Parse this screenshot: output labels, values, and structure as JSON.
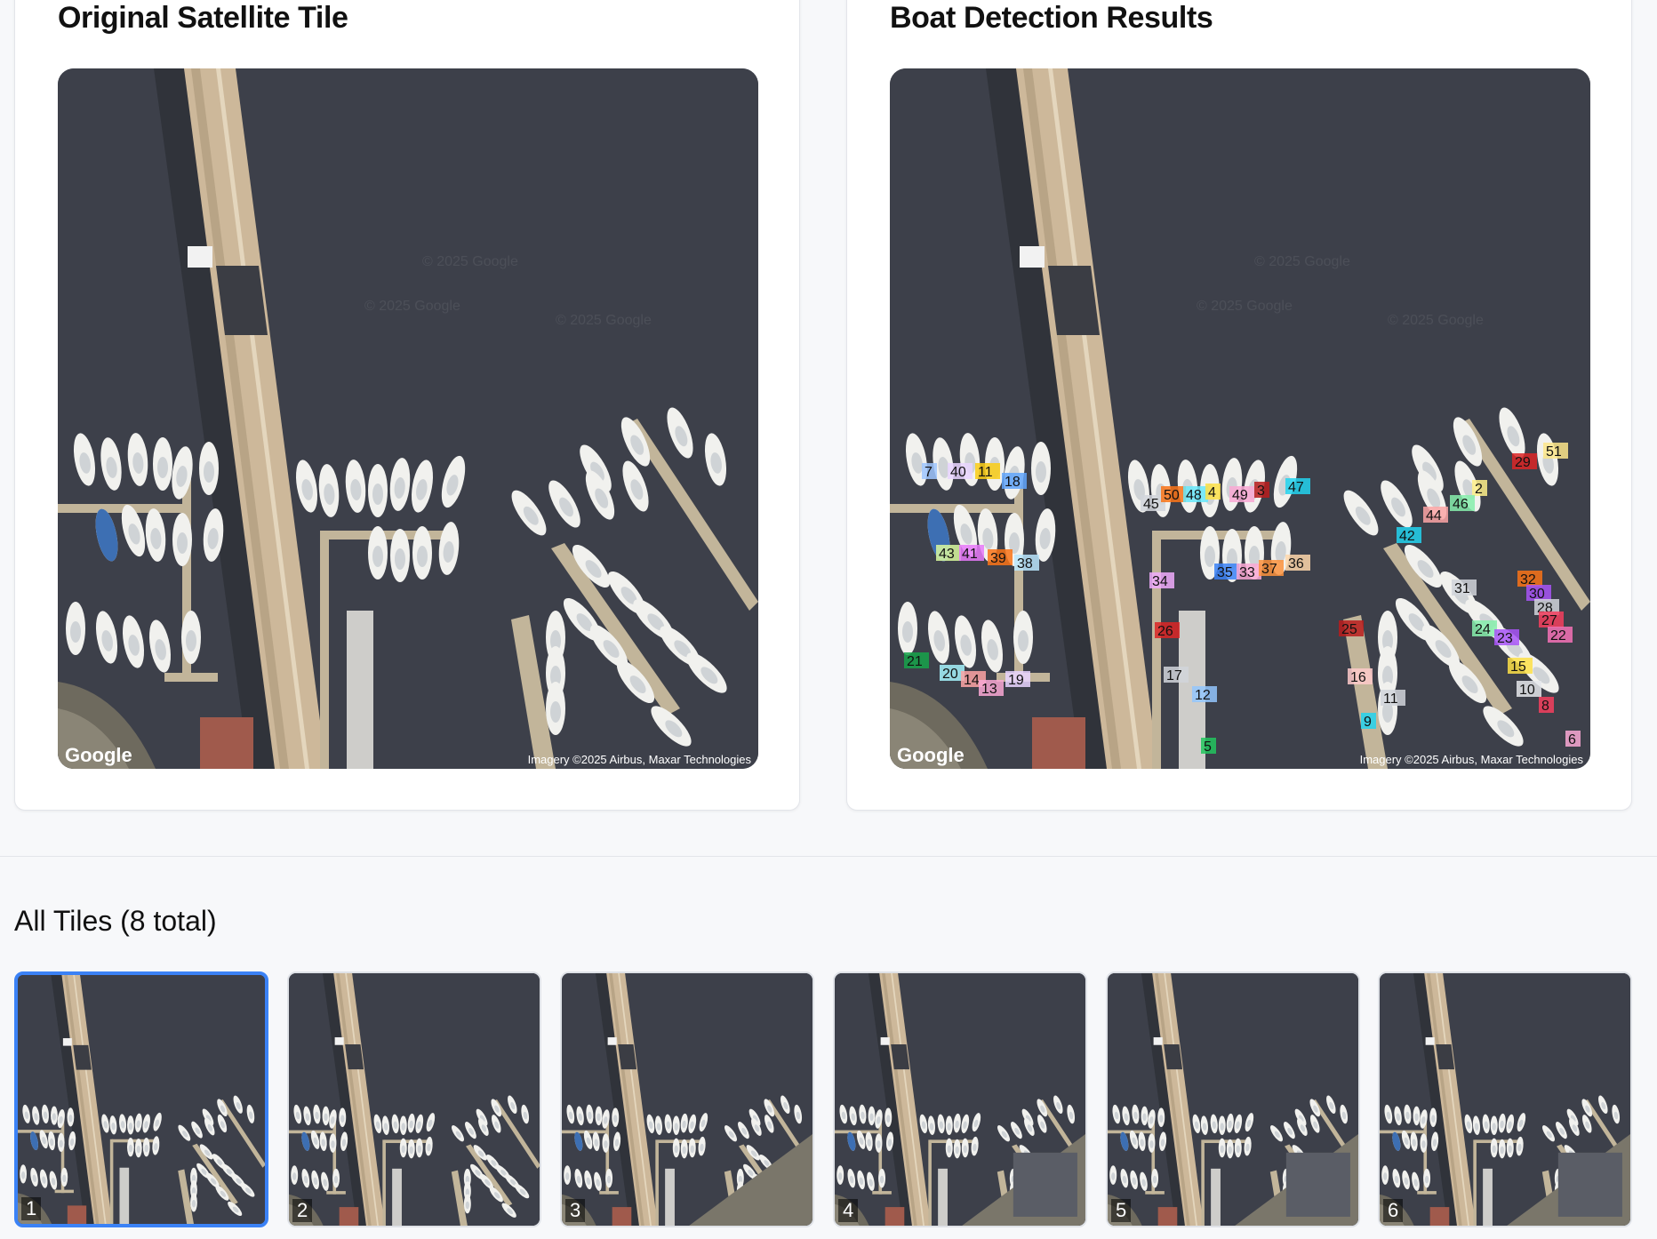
{
  "left_panel": {
    "title": "Original Satellite Tile"
  },
  "right_panel": {
    "title": "Boat Detection Results"
  },
  "map": {
    "google_logo": "Google",
    "attribution": "Imagery ©2025 Airbus, Maxar Technologies",
    "watermark": "© 2025 Google"
  },
  "tiles_section": {
    "title": "All Tiles (8 total)"
  },
  "thumbnails": [
    {
      "num": "1",
      "selected": true
    },
    {
      "num": "2",
      "selected": false
    },
    {
      "num": "3",
      "selected": false
    },
    {
      "num": "4",
      "selected": false
    },
    {
      "num": "5",
      "selected": false
    },
    {
      "num": "6",
      "selected": false
    }
  ],
  "detections": [
    {
      "id": "7",
      "color": "#9ec5fe"
    },
    {
      "id": "40",
      "color": "#e9d5ff"
    },
    {
      "id": "11",
      "color": "#facc15"
    },
    {
      "id": "18",
      "color": "#60a5fa"
    },
    {
      "id": "45",
      "color": "#d1d5db"
    },
    {
      "id": "50",
      "color": "#f97316"
    },
    {
      "id": "48",
      "color": "#67e8f9"
    },
    {
      "id": "4",
      "color": "#fde047"
    },
    {
      "id": "49",
      "color": "#f9a8d4"
    },
    {
      "id": "3",
      "color": "#b91c1c"
    },
    {
      "id": "47",
      "color": "#22d3ee"
    },
    {
      "id": "29",
      "color": "#dc2626"
    },
    {
      "id": "51",
      "color": "#fde68a"
    },
    {
      "id": "2",
      "color": "#fef08a"
    },
    {
      "id": "46",
      "color": "#86efac"
    },
    {
      "id": "44",
      "color": "#fca5a5"
    },
    {
      "id": "42",
      "color": "#22d3ee"
    },
    {
      "id": "43",
      "color": "#d9f99d"
    },
    {
      "id": "41",
      "color": "#e879f9"
    },
    {
      "id": "39",
      "color": "#f97316"
    },
    {
      "id": "38",
      "color": "#bae6fd"
    },
    {
      "id": "34",
      "color": "#f0abfc"
    },
    {
      "id": "35",
      "color": "#3b82f6"
    },
    {
      "id": "33",
      "color": "#f9a8d4"
    },
    {
      "id": "37",
      "color": "#fb923c"
    },
    {
      "id": "36",
      "color": "#fed7aa"
    },
    {
      "id": "31",
      "color": "#d1d5db"
    },
    {
      "id": "32",
      "color": "#f97316"
    },
    {
      "id": "30",
      "color": "#a855f7"
    },
    {
      "id": "28",
      "color": "#d1d5db"
    },
    {
      "id": "26",
      "color": "#dc2626"
    },
    {
      "id": "25",
      "color": "#b91c1c"
    },
    {
      "id": "24",
      "color": "#86efac"
    },
    {
      "id": "23",
      "color": "#a855f7"
    },
    {
      "id": "27",
      "color": "#f43f5e"
    },
    {
      "id": "22",
      "color": "#f472b6"
    },
    {
      "id": "21",
      "color": "#16a34a"
    },
    {
      "id": "20",
      "color": "#a5f3fc"
    },
    {
      "id": "14",
      "color": "#fca5a5"
    },
    {
      "id": "13",
      "color": "#f9a8d4"
    },
    {
      "id": "19",
      "color": "#e9d5ff"
    },
    {
      "id": "17",
      "color": "#d1d5db"
    },
    {
      "id": "16",
      "color": "#fecaca"
    },
    {
      "id": "15",
      "color": "#fde047"
    },
    {
      "id": "12",
      "color": "#93c5fd"
    },
    {
      "id": "10",
      "color": "#e5e7eb"
    },
    {
      "id": "9",
      "color": "#22d3ee"
    },
    {
      "id": "11",
      "color": "#d1d5db"
    },
    {
      "id": "8",
      "color": "#f43f5e"
    },
    {
      "id": "5",
      "color": "#22c55e"
    },
    {
      "id": "6",
      "color": "#f9a8d4"
    }
  ]
}
